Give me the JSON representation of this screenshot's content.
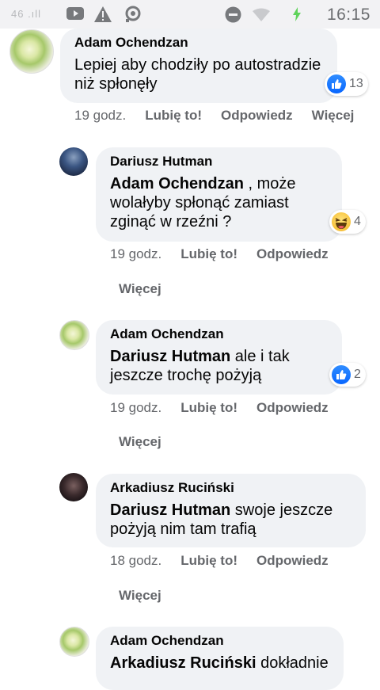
{
  "status_bar": {
    "time": "16:15",
    "signal_text": "46 .ıll",
    "icons": [
      "signal-icon",
      "youtube-icon",
      "warning-icon",
      "location-icon",
      "dnd-icon",
      "wifi-icon",
      "battery-icon"
    ]
  },
  "comments": [
    {
      "author": "Adam Ochendzan",
      "mention": "",
      "text": "Lepiej aby chodziły po autostradzie niż spłonęły",
      "reaction_count": "13",
      "reaction_type": "like",
      "time": "19 godz.",
      "like_label": "Lubię to!",
      "reply_label": "Odpowiedz",
      "more_label": "Więcej"
    },
    {
      "author": "Dariusz Hutman",
      "mention": "Adam Ochendzan",
      "text": " , może wolałyby spłonąć zamiast zginąć w rzeźni ?",
      "reaction_count": "4",
      "reaction_type": "haha",
      "time": "19 godz.",
      "like_label": "Lubię to!",
      "reply_label": "Odpowiedz",
      "more_label": "Więcej"
    },
    {
      "author": "Adam Ochendzan",
      "mention": "Dariusz Hutman",
      "text": " ale i tak jeszcze trochę pożyją",
      "reaction_count": "2",
      "reaction_type": "like",
      "time": "19 godz.",
      "like_label": "Lubię to!",
      "reply_label": "Odpowiedz",
      "more_label": "Więcej"
    },
    {
      "author": "Arkadiusz Ruciński",
      "mention": "Dariusz Hutman",
      "text": " swoje jeszcze pożyją nim tam trafią",
      "time": "18 godz.",
      "like_label": "Lubię to!",
      "reply_label": "Odpowiedz",
      "more_label": "Więcej"
    },
    {
      "author": "Adam Ochendzan",
      "mention": "Arkadiusz Ruciński",
      "text": " dokładnie"
    }
  ],
  "colors": {
    "bubble": "#f0f2f5",
    "meta": "#65676b",
    "like_blue": "#0866ff"
  }
}
